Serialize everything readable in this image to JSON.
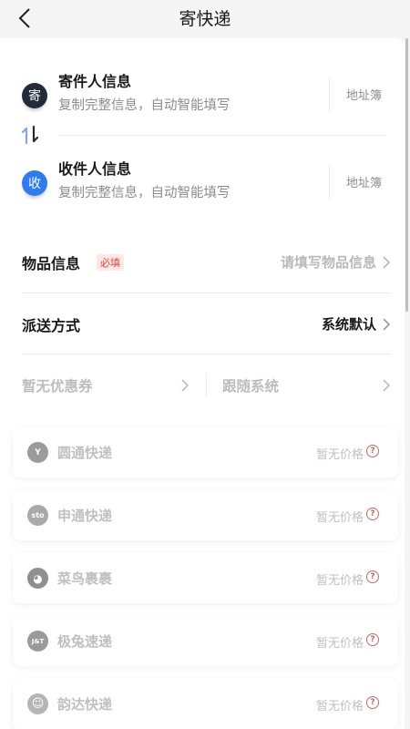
{
  "header": {
    "title": "寄快递"
  },
  "sender": {
    "avatar_char": "寄",
    "title": "寄件人信息",
    "hint": "复制完整信息，自动智能填写",
    "address_book": "地址簿"
  },
  "receiver": {
    "avatar_char": "收",
    "title": "收件人信息",
    "hint": "复制完整信息，自动智能填写",
    "address_book": "地址簿"
  },
  "item_info": {
    "label": "物品信息",
    "required_badge": "必填",
    "placeholder": "请填写物品信息"
  },
  "delivery": {
    "label": "派送方式",
    "value": "系统默认"
  },
  "coupon": {
    "label": "暂无优惠券"
  },
  "follow": {
    "label": "跟随系统"
  },
  "couriers": [
    {
      "name": "圆通快递",
      "logo_text": "Y",
      "price": "暂无价格"
    },
    {
      "name": "申通快递",
      "logo_text": "sto",
      "price": "暂无价格"
    },
    {
      "name": "菜鸟裹裹",
      "logo_text": "◕",
      "price": "暂无价格"
    },
    {
      "name": "极兔速递",
      "logo_text": "J&T",
      "price": "暂无价格"
    },
    {
      "name": "韵达快递",
      "logo_text": "☺",
      "price": "暂无价格"
    }
  ],
  "question_mark": "?",
  "colors": {
    "accent_blue": "#2f7bf2",
    "dark_avatar": "#232b3a",
    "required_red": "#e0443a"
  }
}
